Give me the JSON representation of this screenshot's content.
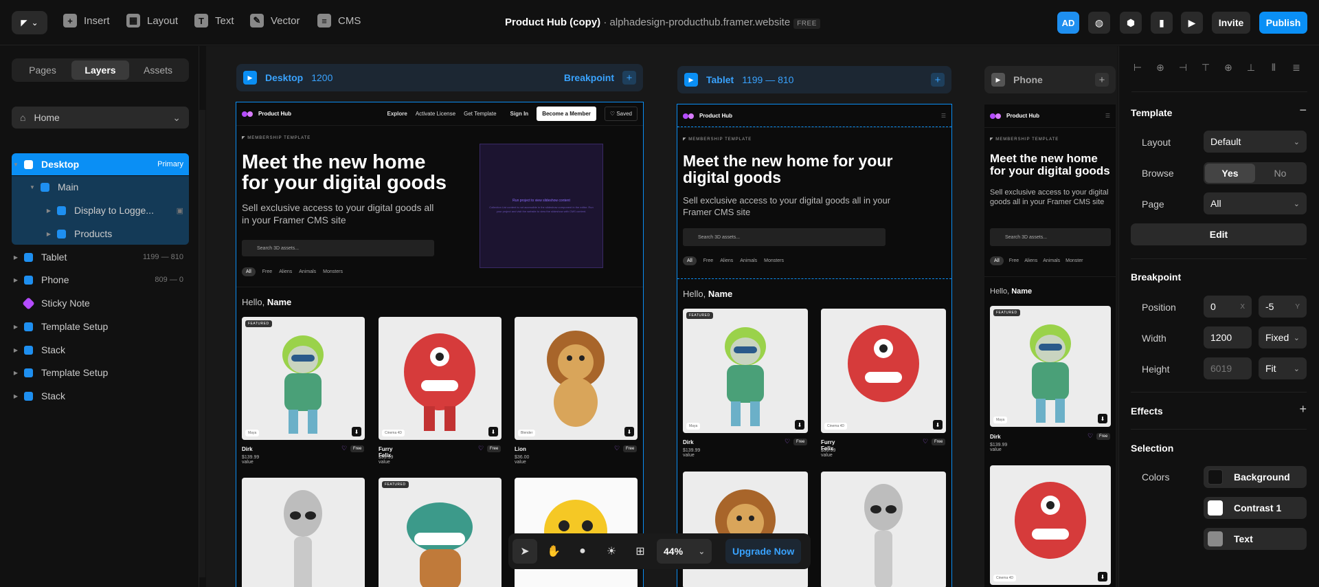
{
  "topbar": {
    "insert": "Insert",
    "layout": "Layout",
    "text": "Text",
    "vector": "Vector",
    "cms": "CMS",
    "project_name": "Product Hub (copy)",
    "separator": " · ",
    "url": "alphadesign-producthub.framer.website",
    "plan": "FREE",
    "avatar": "AD",
    "invite": "Invite",
    "publish": "Publish"
  },
  "left": {
    "tabs": [
      "Pages",
      "Layers",
      "Assets"
    ],
    "page_select": "Home",
    "layers": [
      {
        "label": "Desktop",
        "meta": "Primary"
      },
      {
        "label": "Main",
        "meta": ""
      },
      {
        "label": "Display to Logge...",
        "meta": ""
      },
      {
        "label": "Products",
        "meta": ""
      },
      {
        "label": "Tablet",
        "meta": "1199 — 810"
      },
      {
        "label": "Phone",
        "meta": "809 — 0"
      },
      {
        "label": "Sticky Note",
        "meta": ""
      },
      {
        "label": "Template Setup",
        "meta": ""
      },
      {
        "label": "Stack",
        "meta": ""
      },
      {
        "label": "Template Setup",
        "meta": ""
      },
      {
        "label": "Stack",
        "meta": ""
      }
    ]
  },
  "canvas": {
    "desktop": {
      "name": "Desktop",
      "range": "1200",
      "breakpoint": "Breakpoint"
    },
    "tablet": {
      "name": "Tablet",
      "range": "1199 — 810"
    },
    "phone": {
      "name": "Phone"
    },
    "site": {
      "brand": "Product Hub",
      "nav": [
        "Explore",
        "Activate License",
        "Get Template",
        "Sign In",
        "Become a Member",
        "Saved"
      ],
      "tag": "MEMBERSHIP TEMPLATE",
      "headline": "Meet the new home for your digital goods",
      "subline": "Sell exclusive access to your digital goods all in your Framer CMS site",
      "search": "Search 3D assets...",
      "chips": [
        "All",
        "Free",
        "Aliens",
        "Animals",
        "Monsters"
      ],
      "chips_phone": [
        "All",
        "Free",
        "Aliens",
        "Animals",
        "Monster"
      ],
      "hello": "Hello,",
      "hello_name": "Name",
      "slideshow_title": "Run project to view slideshow content",
      "slideshow_body": "Collection List content is not accessible in the slideshow component in the editor. Run your project and visit the website to view the slideshow with CMS content.",
      "featured": "FEATURED",
      "free": "Free",
      "products": [
        {
          "name": "Dirk",
          "price": "$139.99 value",
          "software": "Maya"
        },
        {
          "name": "Furry Felix",
          "price": "$99.99 value",
          "software": "Cinema 4D"
        },
        {
          "name": "Lion",
          "price": "$36.00 value",
          "software": "Blender"
        }
      ]
    }
  },
  "floatbar": {
    "zoom": "44%",
    "upgrade": "Upgrade Now"
  },
  "right": {
    "template": "Template",
    "layout_label": "Layout",
    "layout_value": "Default",
    "browse_label": "Browse",
    "browse_yes": "Yes",
    "browse_no": "No",
    "page_label": "Page",
    "page_value": "All",
    "edit": "Edit",
    "breakpoint": "Breakpoint",
    "position_label": "Position",
    "pos_x": "0",
    "pos_x_unit": "X",
    "pos_y": "-5",
    "pos_y_unit": "Y",
    "width_label": "Width",
    "width_value": "1200",
    "width_mode": "Fixed",
    "height_label": "Height",
    "height_value": "6019",
    "height_mode": "Fit",
    "effects": "Effects",
    "selection": "Selection",
    "colors_label": "Colors",
    "colors": [
      {
        "name": "Background",
        "hex": "#111111"
      },
      {
        "name": "Contrast 1",
        "hex": "#ffffff"
      },
      {
        "name": "Text",
        "hex": "#8a8a8a"
      }
    ]
  },
  "accent": "#0a8ff5"
}
